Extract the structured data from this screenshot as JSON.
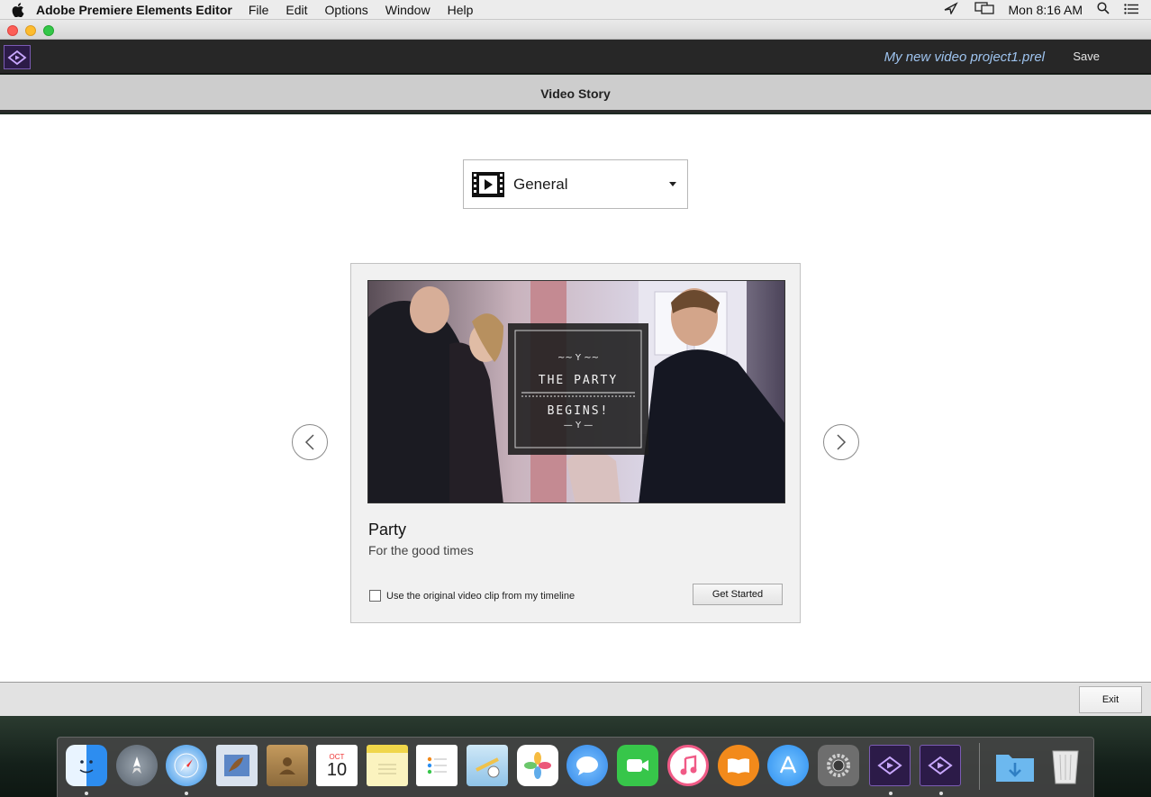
{
  "menubar": {
    "app_name": "Adobe Premiere Elements Editor",
    "items": [
      "File",
      "Edit",
      "Options",
      "Window",
      "Help"
    ],
    "clock": "Mon 8:16 AM"
  },
  "toolbar": {
    "project_name": "My new video project1.prel",
    "save_label": "Save"
  },
  "header": {
    "title": "Video Story"
  },
  "theme_select": {
    "selected": "General"
  },
  "card": {
    "preview_line1": "THE PARTY",
    "preview_line2": "BEGINS!",
    "title": "Party",
    "subtitle": "For the good times",
    "checkbox_label": "Use the original video clip from my timeline",
    "get_started_label": "Get Started"
  },
  "footer": {
    "exit_label": "Exit"
  },
  "calendar_icon": {
    "month": "OCT",
    "day": "10"
  },
  "dock": [
    {
      "name": "finder-icon",
      "color": "#2d8df0"
    },
    {
      "name": "launchpad-icon",
      "color": "#6f7a86"
    },
    {
      "name": "safari-icon",
      "color": "#2f8fe6"
    },
    {
      "name": "mail-icon",
      "color": "#5b86c6"
    },
    {
      "name": "contacts-icon",
      "color": "#b08a52"
    },
    {
      "name": "calendar-icon",
      "color": "#ffffff"
    },
    {
      "name": "notes-icon",
      "color": "#f6e27a"
    },
    {
      "name": "reminders-icon",
      "color": "#ffffff"
    },
    {
      "name": "maps-icon",
      "color": "#8fc3e8"
    },
    {
      "name": "photos-icon",
      "color": "#ffffff"
    },
    {
      "name": "messages-icon",
      "color": "#3a9df3"
    },
    {
      "name": "facetime-icon",
      "color": "#37c64a"
    },
    {
      "name": "itunes-icon",
      "color": "#f05a86"
    },
    {
      "name": "ibooks-icon",
      "color": "#f28a1b"
    },
    {
      "name": "app-store-icon",
      "color": "#2b8ef0"
    },
    {
      "name": "system-preferences-icon",
      "color": "#8b8b8b"
    },
    {
      "name": "premiere-elements-icon",
      "color": "#2c1b48"
    },
    {
      "name": "premiere-elements-organizer-icon",
      "color": "#2c1b48"
    },
    {
      "name": "downloads-folder-icon",
      "color": "#6cb8ef"
    },
    {
      "name": "trash-icon",
      "color": "#d9d9d9"
    }
  ]
}
